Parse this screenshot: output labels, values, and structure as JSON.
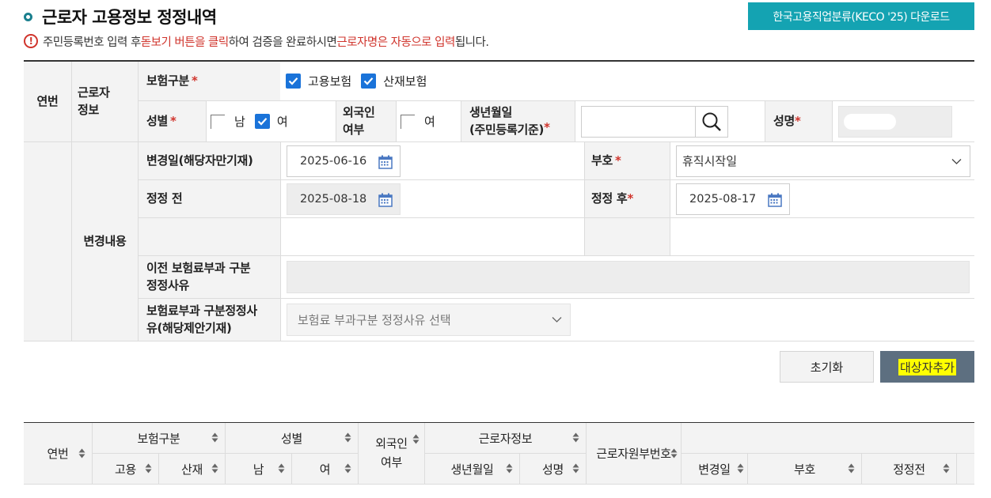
{
  "header": {
    "title": "근로자 고용정보 정정내역",
    "keco_download_label": "한국고용직업분류(KECO '25) 다운로드"
  },
  "notice": {
    "part1": "주민등록번호 입력 후 ",
    "part2": "돋보기 버튼을 클릭",
    "part3": "하여 검증을 완료하시면 ",
    "part4": "근로자명은 자동으로 입력",
    "part5": "됩니다."
  },
  "form": {
    "serial_label": "연번",
    "worker_info_label": "근로자\n정보",
    "insurance_type_label": "보험구분",
    "insurance_options": [
      {
        "label": "고용보험",
        "checked": true
      },
      {
        "label": "산재보험",
        "checked": true
      }
    ],
    "gender_label": "성별",
    "gender_options": [
      {
        "label": "남",
        "checked": false
      },
      {
        "label": "여",
        "checked": true
      }
    ],
    "foreigner_label": "외국인\n여부",
    "foreigner_option": {
      "label": "여",
      "checked": false
    },
    "birth_label": "생년월일\n(주민등록기준)",
    "birth_value": "",
    "name_label": "성명",
    "name_value": "",
    "change_content_label": "변경내용",
    "change_date_label": "변경일(해당자만기재)",
    "change_date_value": "2025-06-16",
    "code_label": "부호",
    "code_value": "휴직시작일",
    "before_label": "정정 전",
    "before_value": "2025-08-18",
    "after_label": "정정 후",
    "after_value": "2025-08-17",
    "prev_reason_label": "이전 보험료부과 구분\n정정사유",
    "prev_reason_value": "",
    "reason_label": "보험료부과 구분정정사\n유(해당제안기재)",
    "reason_placeholder": "보험료 부과구분 정정사유 선택"
  },
  "buttons": {
    "reset": "초기화",
    "add_target": "대상자추가"
  },
  "grid": {
    "headers": {
      "serial": "연번",
      "insurance": "보험구분",
      "employment": "고용",
      "industrial": "산재",
      "gender": "성별",
      "male": "남",
      "female": "여",
      "foreigner": "외국인\n여부",
      "worker_info": "근로자정보",
      "birth": "생년월일",
      "name": "성명",
      "worker_id": "근로자원부번호",
      "change_date": "변경일",
      "code": "부호",
      "before": "정정전"
    }
  },
  "colors": {
    "accent": "#14a3b2",
    "required": "#d0342c",
    "checkbox": "#1a73d9",
    "add_button": "#5d6f80",
    "highlight": "#ffff00"
  }
}
